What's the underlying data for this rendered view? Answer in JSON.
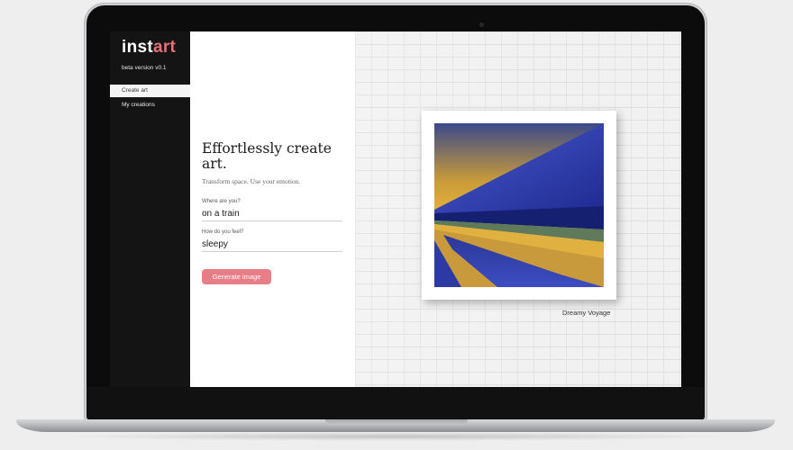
{
  "app": {
    "logo_part1": "inst",
    "logo_part2": "art",
    "version": "beta version v0.1"
  },
  "sidebar": {
    "items": [
      {
        "label": "Create art",
        "active": true
      },
      {
        "label": "My creations",
        "active": false
      }
    ]
  },
  "form": {
    "headline": "Effortlessly create art.",
    "subline": "Transform space. Use your emotion.",
    "fields": [
      {
        "label": "Where are you?",
        "value": "on a train"
      },
      {
        "label": "How do you feel?",
        "value": "sleepy"
      }
    ],
    "button_label": "Generate image"
  },
  "artwork": {
    "caption": "Dreamy Voyage"
  },
  "colors": {
    "accent": "#e77d86",
    "logo_accent": "#e8707a",
    "sidebar_bg": "#141414",
    "art_blue": "#2b3aa8",
    "art_yellow": "#e8b43a"
  }
}
